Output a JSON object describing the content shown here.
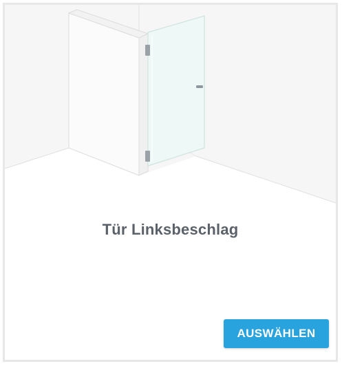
{
  "card": {
    "title": "Tür Linksbeschlag",
    "select_label": "AUSWÄHLEN",
    "image_icon": "shower-door-left-hinge-illustration"
  },
  "colors": {
    "accent": "#28a3de",
    "title_text": "#5a6168",
    "card_border": "#e6e7e8",
    "glass_tint": "#eef8f6"
  }
}
